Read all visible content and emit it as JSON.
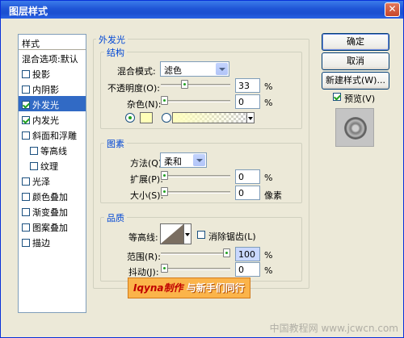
{
  "window": {
    "title": "图层样式",
    "close_glyph": "✕"
  },
  "style_list": {
    "header": "样式",
    "items": [
      {
        "label": "混合选项:默认",
        "checkbox": false,
        "checked": false,
        "indent": false,
        "selected": false
      },
      {
        "label": "投影",
        "checkbox": true,
        "checked": false,
        "indent": false,
        "selected": false
      },
      {
        "label": "内阴影",
        "checkbox": true,
        "checked": false,
        "indent": false,
        "selected": false
      },
      {
        "label": "外发光",
        "checkbox": true,
        "checked": true,
        "indent": false,
        "selected": true
      },
      {
        "label": "内发光",
        "checkbox": true,
        "checked": true,
        "indent": false,
        "selected": false
      },
      {
        "label": "斜面和浮雕",
        "checkbox": true,
        "checked": false,
        "indent": false,
        "selected": false
      },
      {
        "label": "等高线",
        "checkbox": true,
        "checked": false,
        "indent": true,
        "selected": false
      },
      {
        "label": "纹理",
        "checkbox": true,
        "checked": false,
        "indent": true,
        "selected": false
      },
      {
        "label": "光泽",
        "checkbox": true,
        "checked": false,
        "indent": false,
        "selected": false
      },
      {
        "label": "颜色叠加",
        "checkbox": true,
        "checked": false,
        "indent": false,
        "selected": false
      },
      {
        "label": "渐变叠加",
        "checkbox": true,
        "checked": false,
        "indent": false,
        "selected": false
      },
      {
        "label": "图案叠加",
        "checkbox": true,
        "checked": false,
        "indent": false,
        "selected": false
      },
      {
        "label": "描边",
        "checkbox": true,
        "checked": false,
        "indent": false,
        "selected": false
      }
    ]
  },
  "panel": {
    "title": "外发光",
    "structure": {
      "title": "结构",
      "blend_mode_label": "混合模式:",
      "blend_mode_value": "滤色",
      "opacity_label": "不透明度(O):",
      "opacity_value": "33",
      "opacity_unit": "%",
      "opacity_fraction": 0.33,
      "noise_label": "杂色(N):",
      "noise_value": "0",
      "noise_unit": "%",
      "noise_fraction": 0,
      "color_swatch": "#ffffb8",
      "gradient_color": "#ffffbe"
    },
    "elements": {
      "title": "图素",
      "technique_label": "方法(Q):",
      "technique_value": "柔和",
      "spread_label": "扩展(P):",
      "spread_value": "0",
      "spread_unit": "%",
      "spread_fraction": 0,
      "size_label": "大小(S):",
      "size_value": "0",
      "size_unit": "像素",
      "size_fraction": 0
    },
    "quality": {
      "title": "品质",
      "contour_label": "等高线:",
      "anti_alias_label": "消除锯齿(L)",
      "anti_alias_checked": false,
      "range_label": "范围(R):",
      "range_value": "100",
      "range_unit": "%",
      "range_fraction": 1,
      "jitter_label": "抖动(J):",
      "jitter_value": "0",
      "jitter_unit": "%",
      "jitter_fraction": 0
    }
  },
  "buttons": {
    "ok": "确定",
    "cancel": "取消",
    "new_style": "新建样式(W)...",
    "preview_label": "预览(V)",
    "preview_checked": true
  },
  "watermark": {
    "script": "Iqyna制作",
    "text": " 与新手们同行"
  },
  "site_mark": "中国教程网 www.jcwcn.com",
  "colors": {
    "title_bar": "#1f55d6",
    "selection": "#316ac5",
    "accent_green": "#21a121"
  }
}
